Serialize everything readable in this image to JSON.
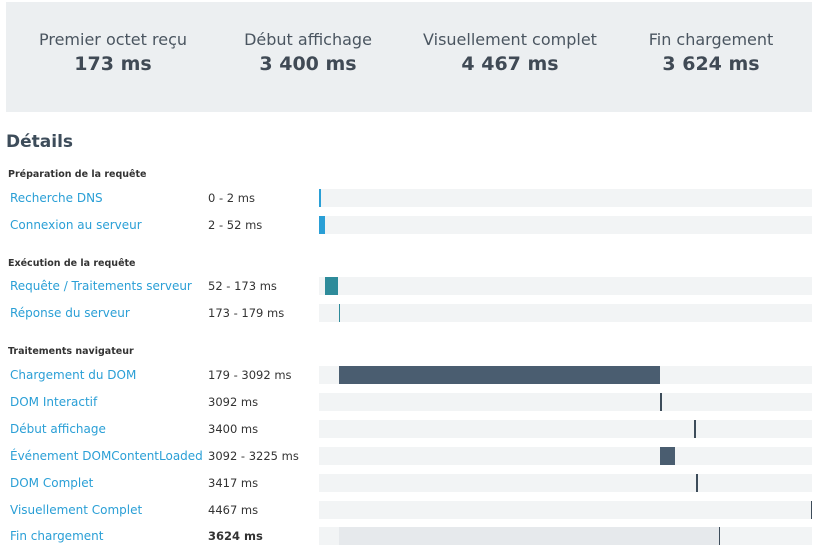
{
  "summary": [
    {
      "label": "Premier octet reçu",
      "value": "173 ms"
    },
    {
      "label": "Début affichage",
      "value": "3 400 ms"
    },
    {
      "label": "Visuellement complet",
      "value": "4 467 ms"
    },
    {
      "label": "Fin chargement",
      "value": "3 624 ms"
    }
  ],
  "details": {
    "title": "Détails",
    "scale_max_ms": 4467,
    "sections": [
      {
        "title": "Préparation de la requête",
        "rows": [
          {
            "name": "Recherche DNS",
            "timing": "0 - 2 ms",
            "start": 0,
            "end": 2,
            "kind": "mark",
            "color": "#2a9fd6"
          },
          {
            "name": "Connexion au serveur",
            "timing": "2 - 52 ms",
            "start": 2,
            "end": 52,
            "kind": "bar",
            "color": "#2a9fd6"
          }
        ]
      },
      {
        "title": "Exécution de la requête",
        "rows": [
          {
            "name": "Requête / Traitements serveur",
            "timing": "52 - 173 ms",
            "start": 52,
            "end": 173,
            "kind": "bar",
            "color": "#2e8b9a"
          },
          {
            "name": "Réponse du serveur",
            "timing": "173 - 179 ms",
            "start": 173,
            "end": 179,
            "kind": "mark",
            "color": "#2e8b9a"
          }
        ]
      },
      {
        "title": "Traitements navigateur",
        "rows": [
          {
            "name": "Chargement du DOM",
            "timing": "179 - 3092 ms",
            "start": 179,
            "end": 3092,
            "kind": "bar",
            "color": "#4a5d70"
          },
          {
            "name": "DOM Interactif",
            "timing": "3092 ms",
            "start": 3092,
            "end": 3092,
            "kind": "mark",
            "color": "#3d4c5a"
          },
          {
            "name": "Début affichage",
            "timing": "3400 ms",
            "start": 3400,
            "end": 3400,
            "kind": "mark",
            "color": "#3d4c5a"
          },
          {
            "name": "Événement DOMContentLoaded",
            "timing": "3092 - 3225 ms",
            "start": 3092,
            "end": 3225,
            "kind": "bar",
            "color": "#4a5d70"
          },
          {
            "name": "DOM Complet",
            "timing": "3417 ms",
            "start": 3417,
            "end": 3417,
            "kind": "mark",
            "color": "#3d4c5a"
          },
          {
            "name": "Visuellement Complet",
            "timing": "4467 ms",
            "start": 4467,
            "end": 4467,
            "kind": "mark",
            "color": "#3d4c5a"
          },
          {
            "name": "Fin chargement",
            "timing": "3624 ms",
            "start": 179,
            "end": 3624,
            "kind": "range-mark",
            "color": "#e6e9ec",
            "bold": true
          }
        ]
      }
    ]
  }
}
